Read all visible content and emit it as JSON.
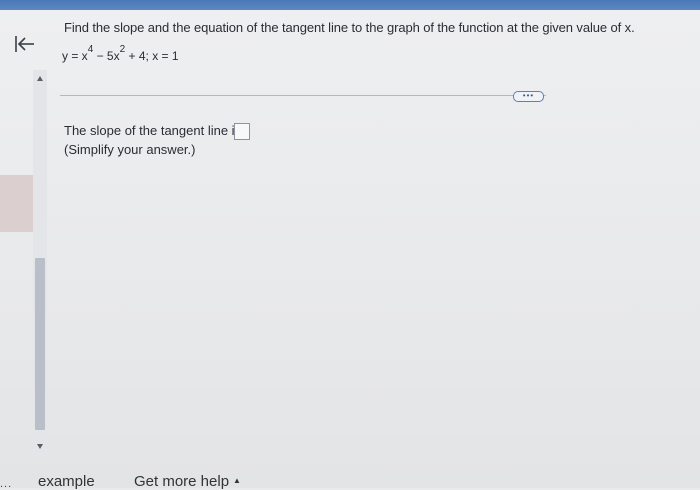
{
  "question": {
    "prompt": "Find the slope and the equation of the tangent line to the graph of the function at the given value of x.",
    "equation": {
      "p1": "y = x",
      "sup1": "4",
      "p2": " − 5x",
      "sup2": "2",
      "p3": " + 4; x = 1"
    }
  },
  "more_button": {
    "label": "•••"
  },
  "answer": {
    "slope_label": "The slope of the tangent line is",
    "hint": "(Simplify your answer.)",
    "slope_value": ""
  },
  "footer": {
    "example_label": "example",
    "ellipsis": "...",
    "help_label": "Get more help"
  },
  "icons": {
    "back": "back-arrow-icon",
    "scroll_up": "caret-up-icon",
    "scroll_down": "caret-down-icon",
    "help_caret": "caret-up-icon"
  },
  "colors": {
    "topbar": "#4a78b8",
    "accent": "#5b7fc2"
  }
}
